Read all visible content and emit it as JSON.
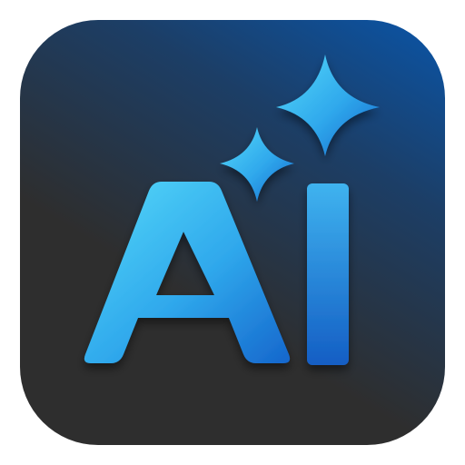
{
  "icon": {
    "name": "ai-sparkle-app-icon",
    "logo_text": "AI",
    "colors": {
      "background_top": "#0A55A8",
      "background_bottom": "#2E2E2E",
      "glyph_light": "#4FD3F7",
      "glyph_mid": "#2FA8EC",
      "glyph_dark": "#1663C8",
      "border": "#FFFFFF"
    },
    "icons": [
      "ai-letters-logo",
      "large-sparkle-icon",
      "small-sparkle-icon"
    ]
  }
}
